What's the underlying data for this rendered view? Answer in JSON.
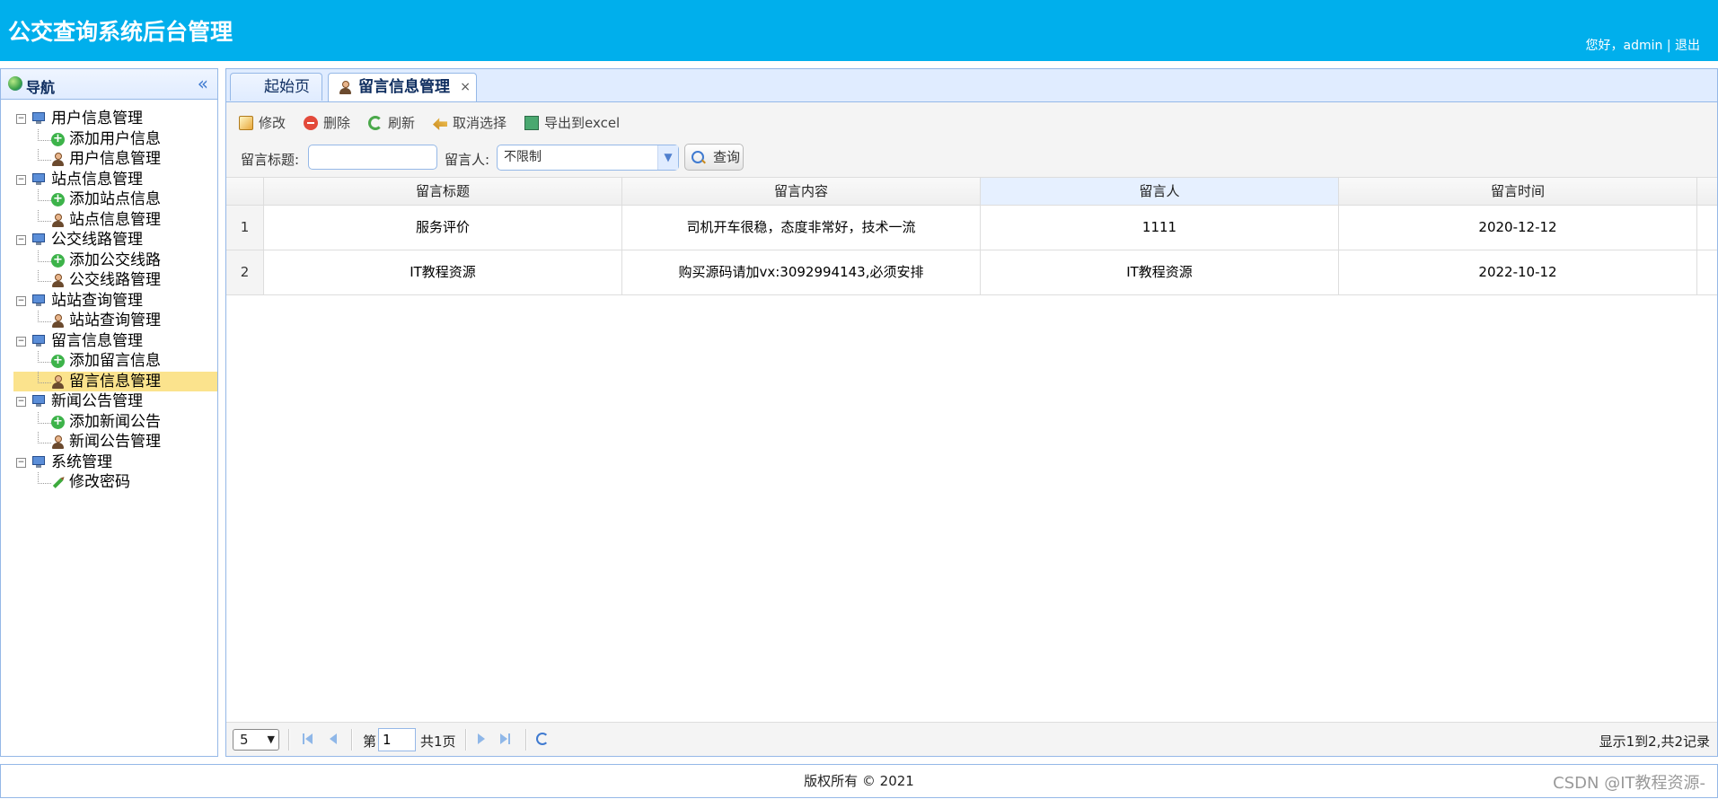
{
  "header": {
    "title": "公交查询系统后台管理",
    "greeting": "您好，",
    "username": "admin",
    "separator": " | ",
    "logout": "退出"
  },
  "sidebar": {
    "title": "导航",
    "collapse_glyph": "«",
    "tree": [
      {
        "label": "用户信息管理",
        "children": [
          {
            "label": "添加用户信息",
            "icon": "add-icon"
          },
          {
            "label": "用户信息管理",
            "icon": "user-icon"
          }
        ]
      },
      {
        "label": "站点信息管理",
        "children": [
          {
            "label": "添加站点信息",
            "icon": "add-icon"
          },
          {
            "label": "站点信息管理",
            "icon": "user-icon"
          }
        ]
      },
      {
        "label": "公交线路管理",
        "children": [
          {
            "label": "添加公交线路",
            "icon": "add-icon"
          },
          {
            "label": "公交线路管理",
            "icon": "user-icon"
          }
        ]
      },
      {
        "label": "站站查询管理",
        "children": [
          {
            "label": "站站查询管理",
            "icon": "user-icon"
          }
        ]
      },
      {
        "label": "留言信息管理",
        "children": [
          {
            "label": "添加留言信息",
            "icon": "add-icon"
          },
          {
            "label": "留言信息管理",
            "icon": "user-icon",
            "selected": true
          }
        ]
      },
      {
        "label": "新闻公告管理",
        "children": [
          {
            "label": "添加新闻公告",
            "icon": "add-icon"
          },
          {
            "label": "新闻公告管理",
            "icon": "user-icon"
          }
        ]
      },
      {
        "label": "系统管理",
        "children": [
          {
            "label": "修改密码",
            "icon": "pencil-icon"
          }
        ]
      }
    ]
  },
  "tabs": {
    "home": "起始页",
    "active": "留言信息管理",
    "close": "×"
  },
  "toolbar": {
    "edit": "修改",
    "delete": "删除",
    "refresh": "刷新",
    "unselect": "取消选择",
    "export": "导出到excel"
  },
  "search": {
    "title_label": "留言标题:",
    "title_value": "",
    "author_label": "留言人:",
    "author_selected": "不限制",
    "query_button": "查询"
  },
  "grid": {
    "columns": [
      "留言标题",
      "留言内容",
      "留言人",
      "留言时间"
    ],
    "rows": [
      {
        "num": "1",
        "title": "服务评价",
        "content": "司机开车很稳，态度非常好，技术一流",
        "author": "1111",
        "time": "2020-12-12"
      },
      {
        "num": "2",
        "title": "IT教程资源",
        "content": "购买源码请加vx:3092994143,必须安排",
        "author": "IT教程资源",
        "time": "2022-10-12"
      }
    ]
  },
  "pager": {
    "page_size": "5",
    "page_prefix": "第",
    "page_value": "1",
    "page_suffix": "共1页",
    "info": "显示1到2,共2记录"
  },
  "footer": {
    "copyright": "版权所有 © 2021",
    "watermark": "CSDN @IT教程资源-"
  }
}
